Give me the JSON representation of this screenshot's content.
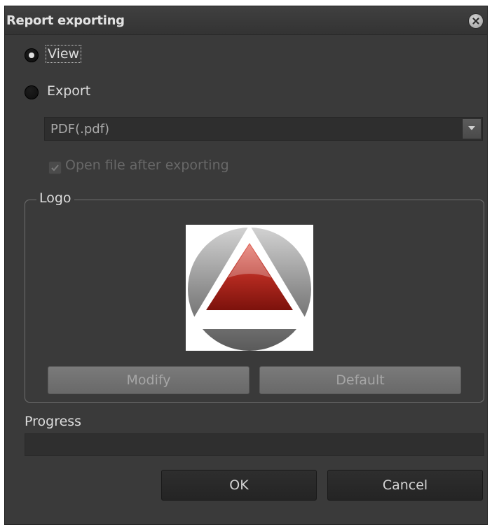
{
  "dialog": {
    "title": "Report exporting",
    "close_icon": "close-circle-icon"
  },
  "mode": {
    "view_label": "View",
    "export_label": "Export",
    "selected": "view"
  },
  "format_select": {
    "value": "PDF(.pdf)",
    "arrow_icon": "chevron-down-icon"
  },
  "open_after_export": {
    "label": "Open file after exporting",
    "checked": true,
    "enabled": false
  },
  "logo": {
    "legend": "Logo",
    "modify_label": "Modify",
    "default_label": "Default"
  },
  "progress": {
    "label": "Progress",
    "value_percent": 0
  },
  "buttons": {
    "ok_label": "OK",
    "cancel_label": "Cancel"
  },
  "colors": {
    "dialog_bg": "#3a3a3a",
    "logo_red": "#b42a20",
    "logo_grey": "#8c8c8c"
  }
}
